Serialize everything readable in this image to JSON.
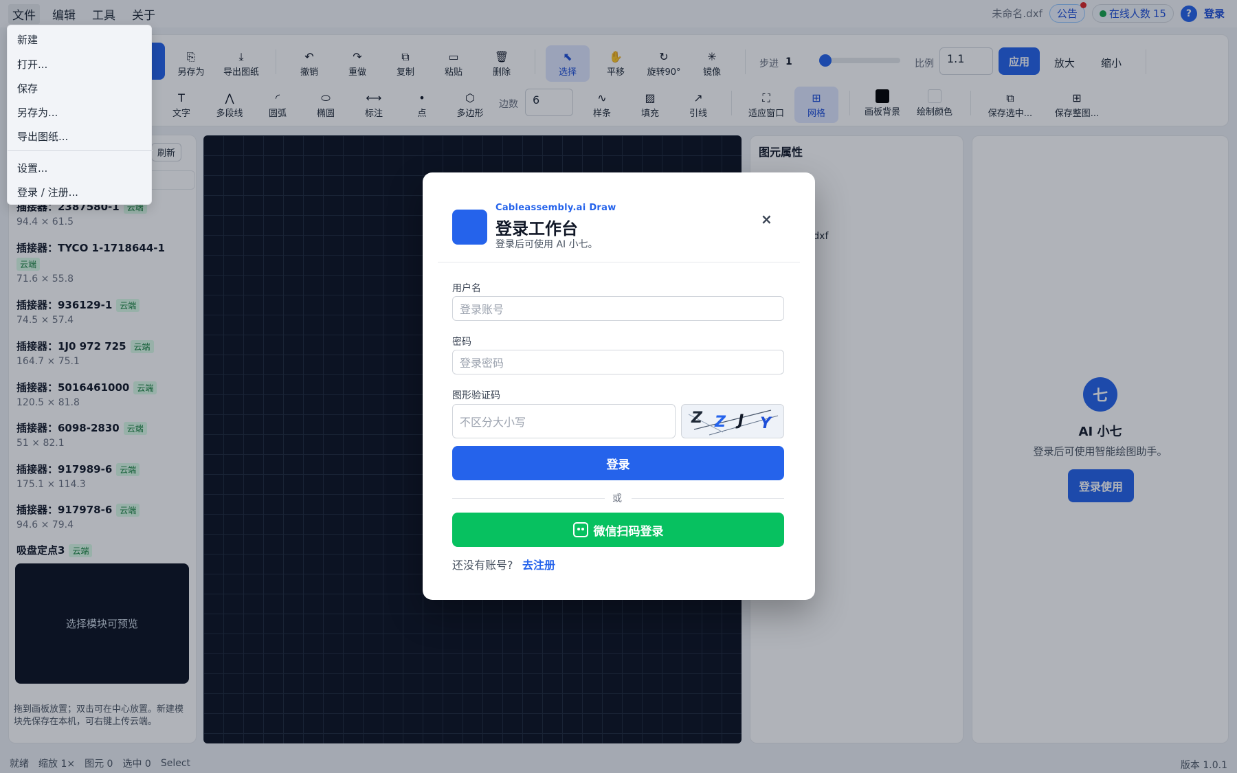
{
  "menubar": {
    "items": [
      "文件",
      "编辑",
      "工具",
      "关于"
    ],
    "filename": "未命名.dxf",
    "notice": "公告",
    "online_label": "在线人数",
    "online_count": "15",
    "help_icon": "?",
    "login": "登录"
  },
  "toolbar": {
    "row1": [
      "另存为",
      "导出图纸",
      "撤销",
      "重做",
      "复制",
      "粘贴",
      "删除",
      "选择",
      "平移",
      "旋转90°",
      "镜像"
    ],
    "step_label": "步进",
    "step_value": "1",
    "step_slider_level": 0,
    "scale_label": "比例",
    "scale_value": "1.1",
    "apply": "应用",
    "zoom_in": "放大",
    "zoom_out": "缩小",
    "row2": [
      "文字",
      "多段线",
      "圆弧",
      "椭圆",
      "标注",
      "点",
      "多边形"
    ],
    "sides_label": "边数",
    "sides_value": "6",
    "row2b": [
      "样条",
      "填充",
      "引线",
      "适应窗口",
      "网格",
      "画板背景",
      "绘制颜色",
      "保存选中...",
      "保存整图..."
    ],
    "selected_tool": "选择",
    "active_toggle": "网格"
  },
  "file_menu": {
    "items": [
      "新建",
      "打开...",
      "保存",
      "另存为...",
      "导出图纸...",
      "设置...",
      "登录 / 注册..."
    ]
  },
  "left_panel": {
    "refresh": "刷新",
    "cloud_tag": "云端",
    "components": [
      {
        "name": "插接器：2387580-1",
        "dim": "94.4 × 61.5"
      },
      {
        "name": "插接器：TYCO 1-1718644-1",
        "dim": "71.6 × 55.8"
      },
      {
        "name": "插接器：936129-1",
        "dim": "74.5 × 57.4"
      },
      {
        "name": "插接器：1J0 972 725",
        "dim": "164.7 × 75.1"
      },
      {
        "name": "插接器：5016461000",
        "dim": "120.5 × 81.8"
      },
      {
        "name": "插接器：6098-2830",
        "dim": "51 × 82.1"
      },
      {
        "name": "插接器：917989-6",
        "dim": "175.1 × 114.3"
      },
      {
        "name": "插接器：917978-6",
        "dim": "94.6 × 79.4"
      },
      {
        "name": "吸盘定点3",
        "dim": ""
      }
    ],
    "preview_text": "选择模块可预览",
    "hint": "拖到画板放置；双击可在中心放置。新建模块先保存在本机，可右键上传云端。"
  },
  "properties": {
    "title": "图元属性",
    "file": "G.dxf"
  },
  "ai_panel": {
    "avatar": "七",
    "name": "AI 小七",
    "desc": "登录后可使用智能绘图助手。",
    "button": "登录使用"
  },
  "login_modal": {
    "brand": "Cableassembly.ai Draw",
    "title": "登录工作台",
    "subtitle": "登录后可使用 AI 小七。",
    "close": "×",
    "username_label": "用户名",
    "username_placeholder": "登录账号",
    "password_label": "密码",
    "password_placeholder": "登录密码",
    "captcha_label": "图形验证码",
    "captcha_placeholder": "不区分大小写",
    "captcha_chars": [
      "Z",
      "Z",
      "J",
      "Y"
    ],
    "submit": "登录",
    "or": "或",
    "wechat": "微信扫码登录",
    "no_account": "还没有账号?",
    "register": "去注册"
  },
  "status": {
    "state": "就绪",
    "zoom": "缩放 1×",
    "elements": "图元 0",
    "selected": "选中 0",
    "mode": "Select",
    "version": "版本 1.0.1"
  },
  "colors": {
    "accent": "#2563eb",
    "wechat": "#07c160",
    "canvas": "#0b1120"
  }
}
